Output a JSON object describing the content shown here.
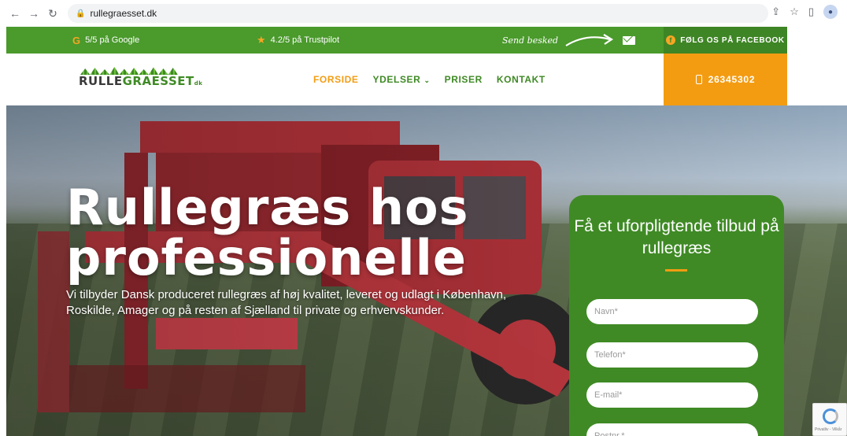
{
  "browser": {
    "url": "rullegraesset.dk",
    "icons": [
      "back-icon",
      "forward-icon",
      "reload-icon",
      "lock-icon",
      "share-icon",
      "star-icon",
      "sidebar-icon",
      "profile-icon"
    ]
  },
  "topbar": {
    "google_rating": "5/5 på Google",
    "trustpilot_rating": "4.2/5 på Trustpilot",
    "send_message": "Send besked",
    "facebook": "FØLG OS PÅ FACEBOOK"
  },
  "header": {
    "logo_part1": "RULLE",
    "logo_part2": "GRAESSET",
    "logo_suffix": "dk",
    "menu": [
      {
        "label": "FORSIDE",
        "active": true
      },
      {
        "label": "YDELSER",
        "dropdown": true
      },
      {
        "label": "PRISER"
      },
      {
        "label": "KONTAKT"
      }
    ],
    "phone": "26345302"
  },
  "hero": {
    "title_line1": "Rullegræs hos",
    "title_line2": "professionelle",
    "subtitle": "Vi tilbyder Dansk produceret rullegræs af høj kvalitet, leveret og udlagt i København, Roskilde, Amager og på resten af Sjælland til private og erhvervskunder."
  },
  "form": {
    "title": "Få et uforpligtende tilbud på rullegræs",
    "fields": [
      {
        "placeholder": "Navn*"
      },
      {
        "placeholder": "Telefon*"
      },
      {
        "placeholder": "E-mail*"
      },
      {
        "placeholder": "Postnr.*"
      }
    ]
  },
  "recaptcha": {
    "text": "Privatliv - Vilkår"
  },
  "colors": {
    "green": "#4a9a2c",
    "dark_green": "#3f8a25",
    "orange": "#f39c12"
  }
}
